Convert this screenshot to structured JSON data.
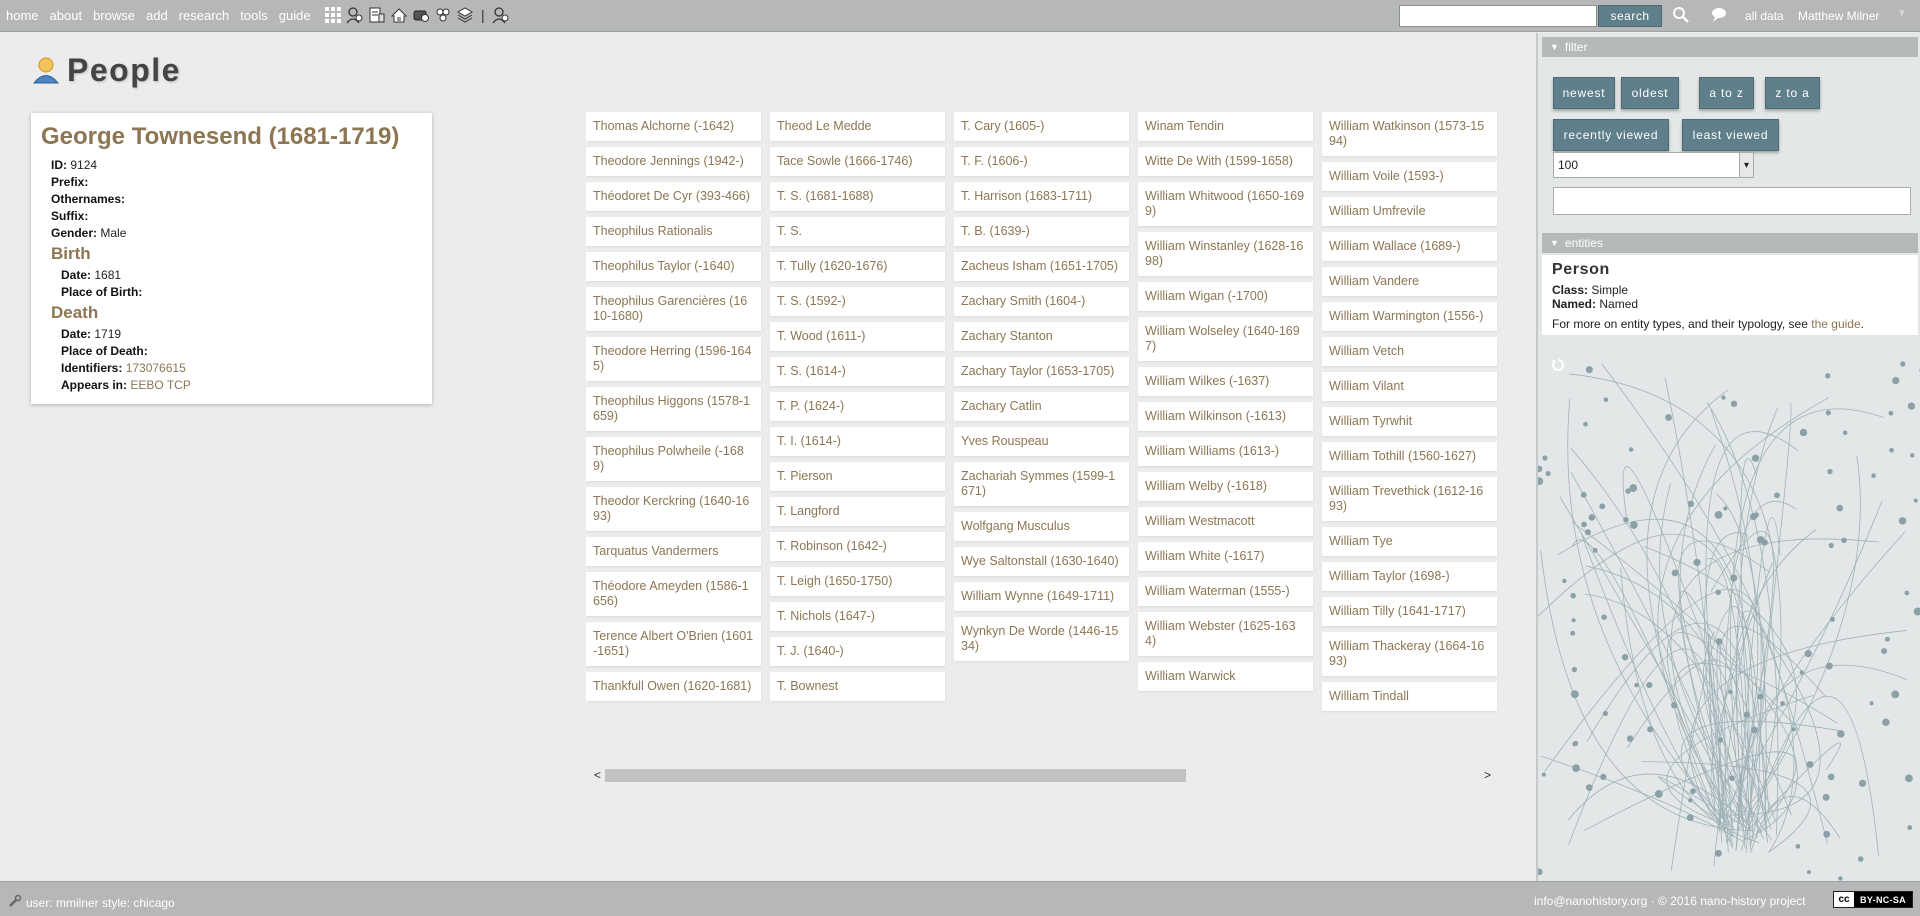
{
  "nav": {
    "items": [
      "home",
      "about",
      "browse",
      "add",
      "research",
      "tools",
      "guide"
    ],
    "search_placeholder": "",
    "search_button": "search",
    "all_data": "all data",
    "user_name": "Matthew Milner"
  },
  "page": {
    "title": "People"
  },
  "person": {
    "name": "George Townesend (1681-1719)",
    "id_label": "ID:",
    "id": "9124",
    "prefix_label": "Prefix:",
    "othernames_label": "Othernames:",
    "suffix_label": "Suffix:",
    "gender_label": "Gender:",
    "gender": "Male",
    "birth_title": "Birth",
    "birth_date_label": "Date:",
    "birth_date": "1681",
    "birth_place_label": "Place of Birth:",
    "death_title": "Death",
    "death_date_label": "Date:",
    "death_date": "1719",
    "death_place_label": "Place of Death:",
    "identifiers_label": "Identifiers:",
    "identifiers": "173076615",
    "appears_label": "Appears in:",
    "appears_in": "EEBO TCP"
  },
  "columns": [
    [
      "Thomas Alchorne (-1642)",
      "Theodore Jennings (1942-)",
      "Théodoret De Cyr (393-466)",
      "Theophilus Rationalis",
      "Theophilus Taylor (-1640)",
      "Theophilus Garencières (1610-1680)",
      "Theodore Herring (1596-1645)",
      "Theophilus Higgons (1578-1659)",
      "Theophilus Polwheile (-1689)",
      "Theodor Kerckring (1640-1693)",
      "Tarquatus Vandermers",
      "Théodore Ameyden (1586-1656)",
      "Terence Albert O'Brien (1601-1651)",
      "Thankfull Owen (1620-1681)"
    ],
    [
      "Theod Le Medde",
      "Tace Sowle (1666-1746)",
      "T. S. (1681-1688)",
      "T. S.",
      "T. Tully (1620-1676)",
      "T. S. (1592-)",
      "T. Wood (1611-)",
      "T. S. (1614-)",
      "T. P. (1624-)",
      "T. I. (1614-)",
      "T. Pierson",
      "T. Langford",
      "T. Robinson (1642-)",
      "T. Leigh (1650-1750)",
      "T. Nichols (1647-)",
      "T. J. (1640-)",
      "T. Bownest"
    ],
    [
      "T. Cary (1605-)",
      "T. F. (1606-)",
      "T. Harrison (1683-1711)",
      "T. B. (1639-)",
      "Zacheus Isham (1651-1705)",
      "Zachary Smith (1604-)",
      "Zachary Stanton",
      "Zachary Taylor (1653-1705)",
      "Zachary Catlin",
      "Yves Rouspeau",
      "Zachariah Symmes (1599-1671)",
      "Wolfgang Musculus",
      "Wye Saltonstall (1630-1640)",
      "William Wynne (1649-1711)",
      "Wynkyn De Worde (1446-1534)"
    ],
    [
      "Winam Tendin",
      "Witte De With (1599-1658)",
      "William Whitwood (1650-1699)",
      "William Winstanley (1628-1698)",
      "William Wigan (-1700)",
      "William Wolseley (1640-1697)",
      "William Wilkes (-1637)",
      "William Wilkinson (-1613)",
      "William Williams (1613-)",
      "William Welby (-1618)",
      "William Westmacott",
      "William White (-1617)",
      "William Waterman (1555-)",
      "William Webster (1625-1634)",
      "William Warwick"
    ],
    [
      "William Watkinson (1573-1594)",
      "William Voile (1593-)",
      "William Umfrevile",
      "William Wallace (1689-)",
      "William Vandere",
      "William Warmington (1556-)",
      "William Vetch",
      "William Vilant",
      "William Tyrwhit",
      "William Tothill (1560-1627)",
      "William Trevethick (1612-1693)",
      "William Tye",
      "William Taylor (1698-)",
      "William Tilly (1641-1717)",
      "William Thackeray (1664-1693)",
      "William Tindall"
    ]
  ],
  "filter": {
    "title": "filter",
    "buttons": [
      "newest",
      "oldest",
      "a to z",
      "z to a",
      "recently viewed",
      "least viewed"
    ],
    "per_page": "100",
    "text_value": ""
  },
  "entities": {
    "title": "entities",
    "type": "Person",
    "class_label": "Class:",
    "class": "Simple",
    "named_label": "Named:",
    "named": "Named",
    "more_text": "For more on entity types, and their typology, see",
    "guide_link": "the guide",
    "period": "."
  },
  "footer": {
    "user_info": "user: mmilner style: chicago",
    "email": "info@nanohistory.org",
    "copyright": " · © 2016 nano-history project",
    "license_left": "cc",
    "license": "BY-NC-SA"
  },
  "colors": {
    "accent": "#8c7653",
    "button": "#5f7f8a",
    "bar": "#b5b7b8"
  }
}
